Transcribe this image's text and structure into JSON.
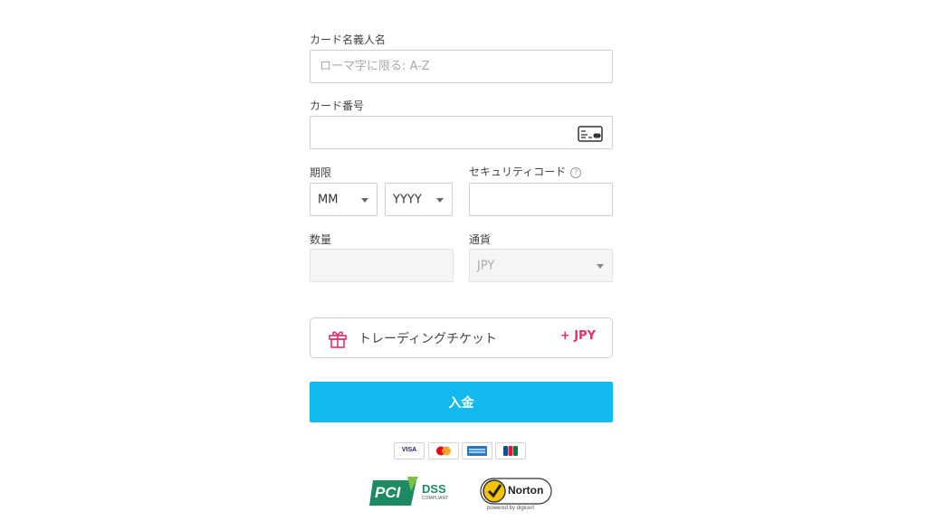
{
  "cardholder": {
    "label": "カード名義人名",
    "placeholder": "ローマ字に限る: A-Z"
  },
  "card_number": {
    "label": "カード番号",
    "icon": "credit-card-icon"
  },
  "expiry": {
    "label": "期限",
    "month": "MM",
    "year": "YYYY"
  },
  "security_code": {
    "label": "セキュリティコード",
    "help": "?"
  },
  "quantity": {
    "label": "数量",
    "value": ""
  },
  "currency": {
    "label": "通貨",
    "value": "JPY"
  },
  "ticket": {
    "icon": "gift-icon",
    "label": "トレーディングチケット",
    "amount": "+ JPY"
  },
  "submit": {
    "label": "入金"
  },
  "payment_methods": [
    "visa",
    "mastercard",
    "amex",
    "jcb"
  ],
  "payment_text": {
    "visa": "VISA"
  },
  "badges": {
    "pci": {
      "main": "PCI",
      "sub": "DSS",
      "note": "COMPLIANT"
    },
    "norton": {
      "main": "Norton",
      "sub": "powered by digicert"
    }
  },
  "colors": {
    "accent": "#12b9ee",
    "ticket_accent": "#e0306e",
    "pci_green": "#1e8a62",
    "norton_yellow": "#f5c400"
  }
}
